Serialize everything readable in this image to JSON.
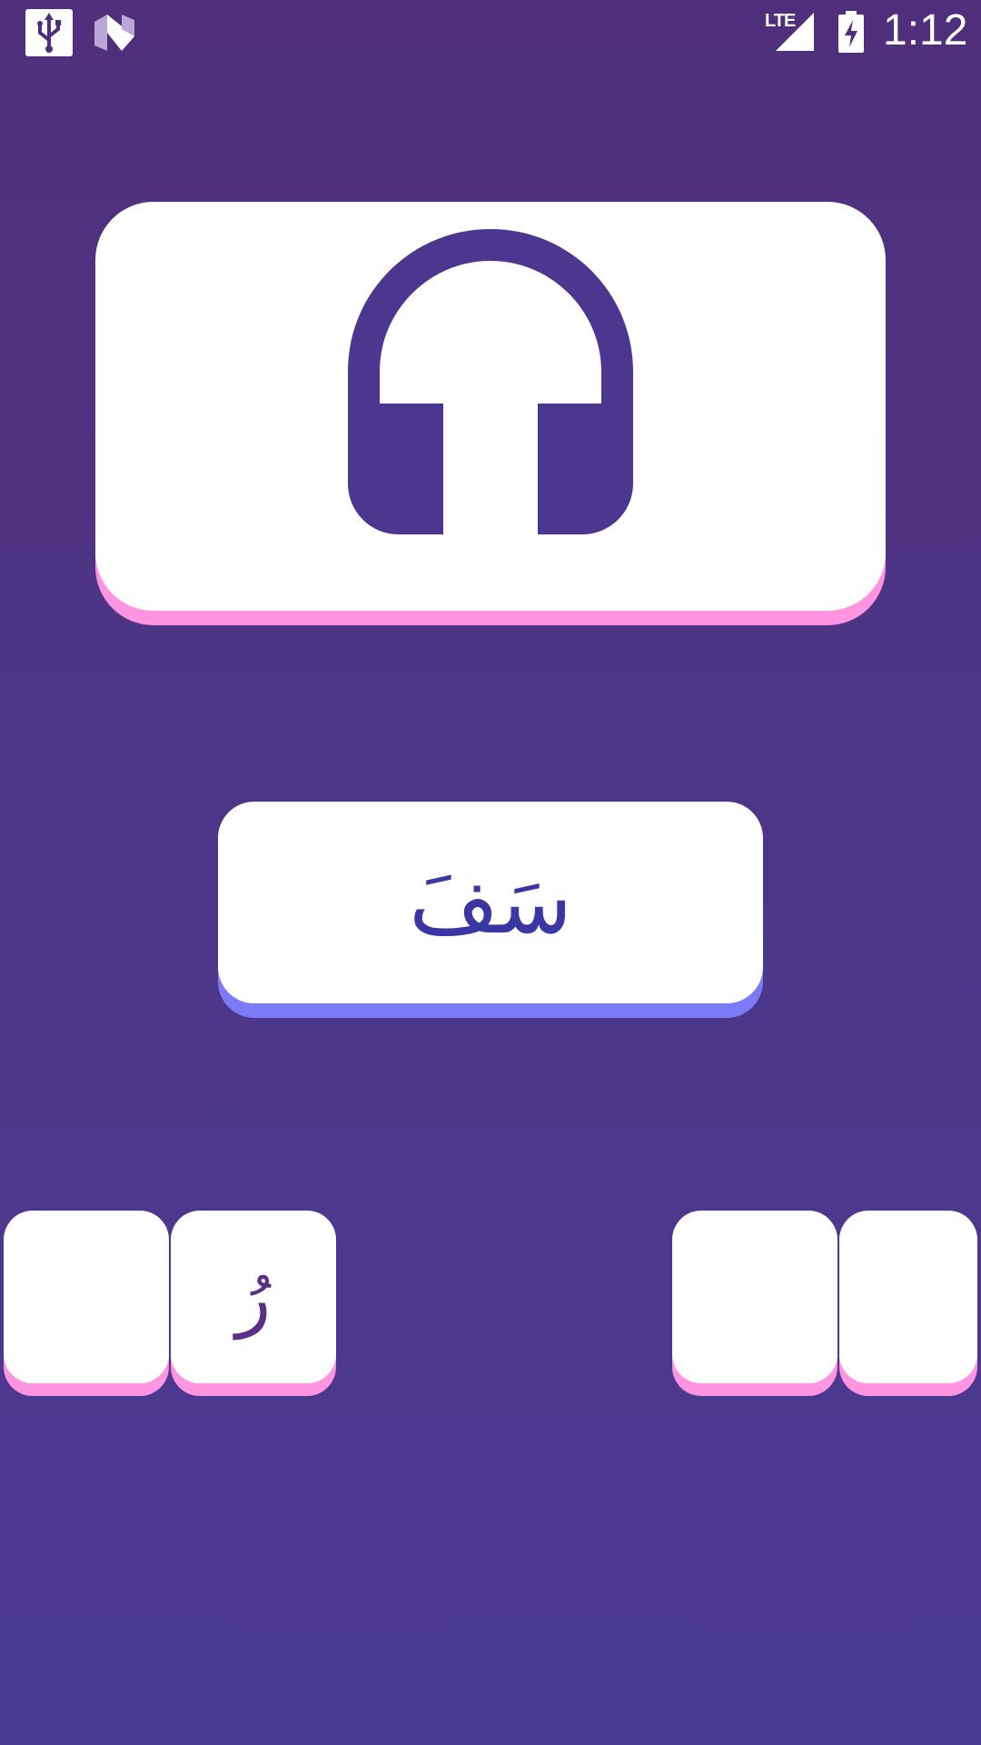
{
  "status_bar": {
    "time": "1:12",
    "network_label": "LTE",
    "icons": [
      "usb-icon",
      "n-preview-icon",
      "lte-signal-icon",
      "battery-charging-icon"
    ]
  },
  "audio_card": {
    "icon": "headphones-icon"
  },
  "syllable_card": {
    "text": "سَفَ"
  },
  "tiles": [
    {
      "label": ""
    },
    {
      "label": "رُ"
    },
    {
      "label": ""
    },
    {
      "label": ""
    }
  ],
  "colors": {
    "background": "#4d3789",
    "card": "#ffffff",
    "pink_accent": "#ff94e0",
    "blue_accent": "#7b7bf8",
    "icon_purple": "#4b3690",
    "syllable_text": "#3a36a4",
    "tile_text": "#5a2f85"
  }
}
